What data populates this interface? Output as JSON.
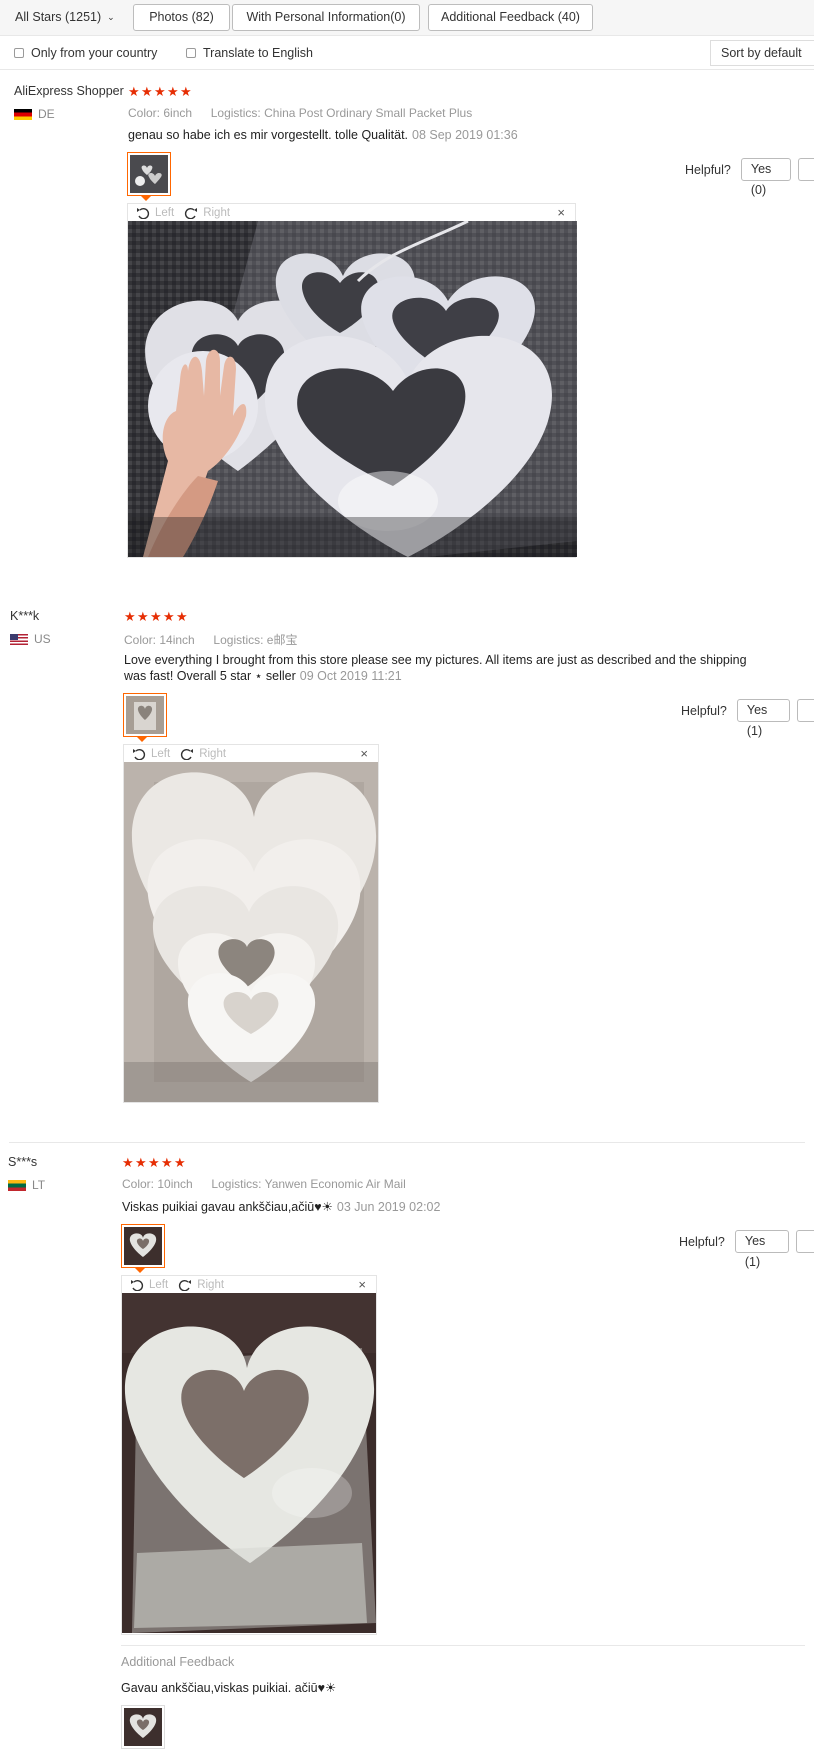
{
  "filter": {
    "all_stars": "All Stars (1251)",
    "photos": "Photos (82)",
    "personal_info": "With Personal Information(0)",
    "additional": "Additional Feedback (40)",
    "only_country": "Only from your country",
    "translate": "Translate to English",
    "sort": "Sort by default"
  },
  "labels": {
    "color": "Color:",
    "logistics": "Logistics:",
    "helpful": "Helpful?",
    "left": "Left",
    "right": "Right",
    "close": "×",
    "additional_feedback": "Additional Feedback"
  },
  "reviews": [
    {
      "user": "AliExpress Shopper",
      "country": "DE",
      "rating": 5,
      "color": "6inch",
      "logistics": "China Post Ordinary Small Packet Plus",
      "text": "genau so habe ich es mir vorgestellt. tolle Qualität.",
      "date": "08 Sep 2019 01:36",
      "yes": "Yes (0)"
    },
    {
      "user": "K***k",
      "country": "US",
      "rating": 5,
      "color": "14inch",
      "logistics": "e邮宝",
      "text_line1": "Love everything I brought from this store please see my pictures. All items are just as described and the shipping",
      "text_line2": "was fast! Overall 5 star ⋆ seller",
      "date": "09 Oct 2019 11:21",
      "yes": "Yes (1)"
    },
    {
      "user": "S***s",
      "country": "LT",
      "rating": 5,
      "color": "10inch",
      "logistics": "Yanwen Economic Air Mail",
      "text": "Viskas puikiai gavau ankščiau,ačiū♥☀",
      "date": "03 Jun 2019 02:02",
      "yes": "Yes (1)",
      "additional_text": "Gavau ankščiau,viskas puikiai. ačiū♥☀"
    }
  ]
}
